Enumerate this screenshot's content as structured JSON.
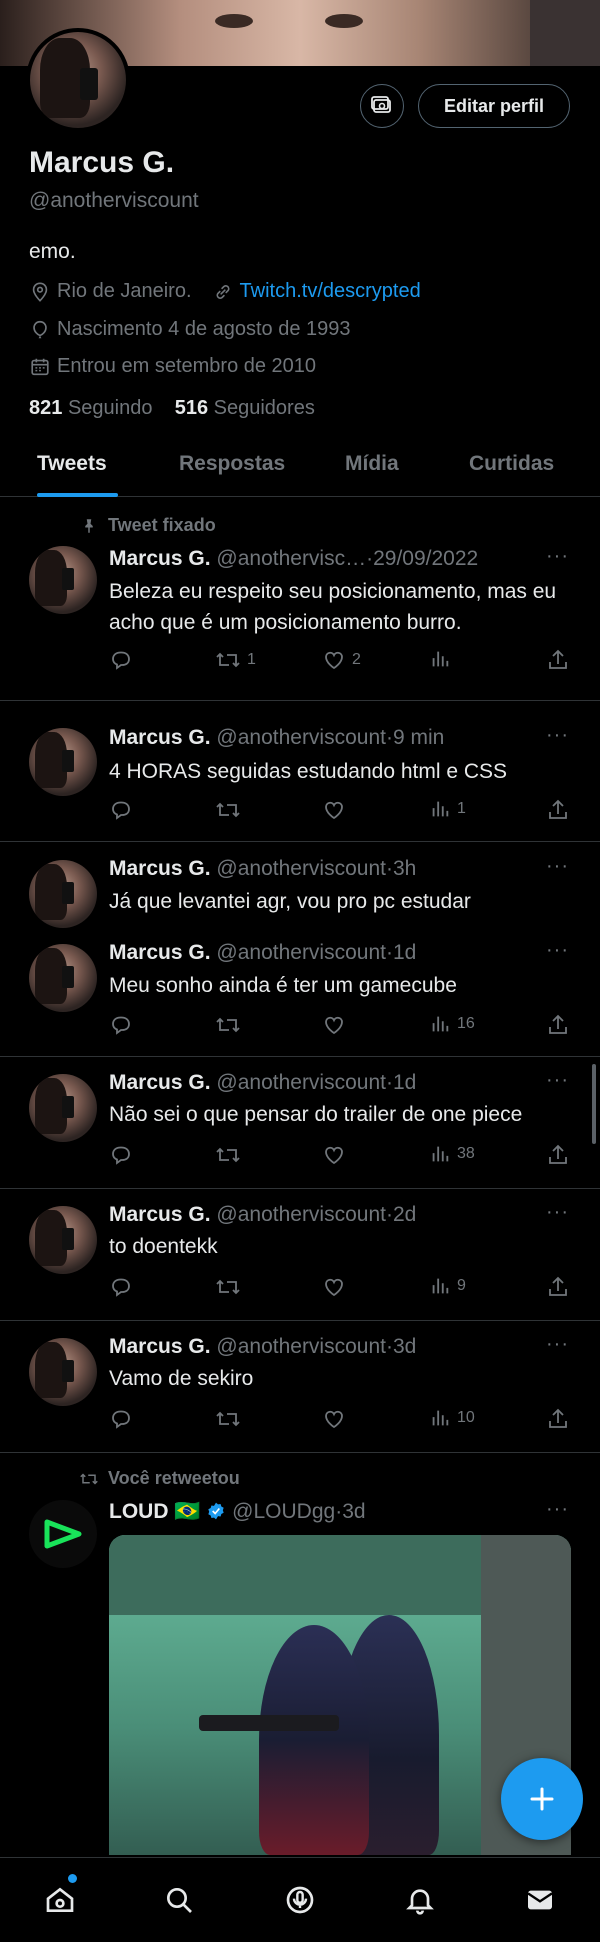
{
  "profile": {
    "name": "Marcus G.",
    "handle": "@anotherviscount",
    "bio": "emo.",
    "location": "Rio de Janeiro.",
    "link": "Twitch.tv/descrypted",
    "birth": "Nascimento 4 de agosto de 1993",
    "joined": "Entrou em setembro de 2010",
    "following_count": "821",
    "following_label": "Seguindo",
    "followers_count": "516",
    "followers_label": "Seguidores",
    "edit_label": "Editar perfil"
  },
  "tabs": [
    {
      "label": "Tweets",
      "active": true
    },
    {
      "label": "Respostas",
      "active": false
    },
    {
      "label": "Mídia",
      "active": false
    },
    {
      "label": "Curtidas",
      "active": false
    }
  ],
  "pinned_label": "Tweet fixado",
  "retweet_label": "Você retweetou",
  "tweets": [
    {
      "name": "Marcus G.",
      "handle": "@anothervisc…",
      "time": "29/09/2022",
      "text": "Beleza eu respeito seu posicionamento, mas eu acho que é um posicionamento burro.",
      "replies": "",
      "retweets": "1",
      "likes": "2",
      "views": ""
    },
    {
      "name": "Marcus G.",
      "handle": "@anotherviscount",
      "time": "9 min",
      "text": "4 HORAS seguidas estudando html e CSS",
      "replies": "",
      "retweets": "",
      "likes": "",
      "views": "1"
    },
    {
      "name": "Marcus G.",
      "handle": "@anotherviscount",
      "time": "3h",
      "text": "Já que levantei agr, vou pro pc estudar"
    },
    {
      "name": "Marcus G.",
      "handle": "@anotherviscount",
      "time": "1d",
      "text": "Meu sonho ainda é ter um gamecube",
      "replies": "",
      "retweets": "",
      "likes": "",
      "views": "16"
    },
    {
      "name": "Marcus G.",
      "handle": "@anotherviscount",
      "time": "1d",
      "text": "Não sei o que pensar do trailer de one piece",
      "replies": "",
      "retweets": "",
      "likes": "",
      "views": "38"
    },
    {
      "name": "Marcus G.",
      "handle": "@anotherviscount",
      "time": "2d",
      "text": "to doentekk",
      "replies": "",
      "retweets": "",
      "likes": "",
      "views": "9"
    },
    {
      "name": "Marcus G.",
      "handle": "@anotherviscount",
      "time": "3d",
      "text": "Vamo de sekiro",
      "replies": "",
      "retweets": "",
      "likes": "",
      "views": "10"
    },
    {
      "name": "LOUD 🇧🇷",
      "handle": "@LOUDgg",
      "time": "3d",
      "text": ""
    }
  ],
  "separator": "·",
  "more": "···",
  "icons": {
    "location": "location-pin-icon",
    "link": "link-icon",
    "birth": "balloon-icon",
    "joined": "calendar-icon",
    "verified": "verified-badge-icon",
    "home": "home-icon",
    "search": "search-icon",
    "spaces": "spaces-icon",
    "notifications": "bell-icon",
    "messages": "mail-icon",
    "compose": "plus-icon"
  },
  "colors": {
    "accent": "#1d9bf0",
    "muted": "#71767b",
    "text": "#e7e9ea",
    "background": "#000000",
    "loud_green": "#19e35a"
  }
}
